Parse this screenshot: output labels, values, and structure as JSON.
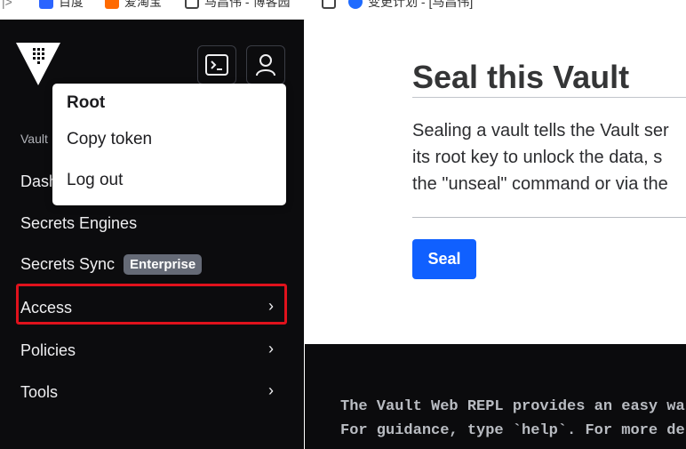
{
  "bookmarks": [
    {
      "label": "百度",
      "color": "#2b64ff"
    },
    {
      "label": "爱淘宝",
      "color": "#ff6a00"
    },
    {
      "label": "马昌伟 - 博客园",
      "color": "#444444"
    },
    {
      "label": "变更计划 - [马昌伟]",
      "color": "#1f6bff"
    }
  ],
  "sidebar": {
    "section_label": "Vault",
    "items": [
      {
        "label": "Dashboard",
        "visible_label": "Dash"
      },
      {
        "label": "Secrets Engines"
      },
      {
        "label": "Secrets Sync",
        "badge": "Enterprise"
      },
      {
        "label": "Access",
        "chevron": "›"
      },
      {
        "label": "Policies",
        "chevron": "›"
      },
      {
        "label": "Tools",
        "chevron": "›"
      }
    ],
    "highlight_color": "#e0121c"
  },
  "header_icons": {
    "console": "terminal-icon",
    "user": "user-icon"
  },
  "user_menu": {
    "title": "Root",
    "items": [
      "Copy token",
      "Log out"
    ]
  },
  "main": {
    "title": "Seal this Vault",
    "description_lines": [
      "Sealing a vault tells the Vault ser",
      "its root key to unlock the data, s",
      "the \"unseal\" command or via the"
    ],
    "seal_button": "Seal",
    "accent_color": "#1060ff"
  },
  "console": {
    "lines": [
      "The Vault Web REPL provides an easy wa",
      "For guidance, type `help`. For more de"
    ]
  }
}
